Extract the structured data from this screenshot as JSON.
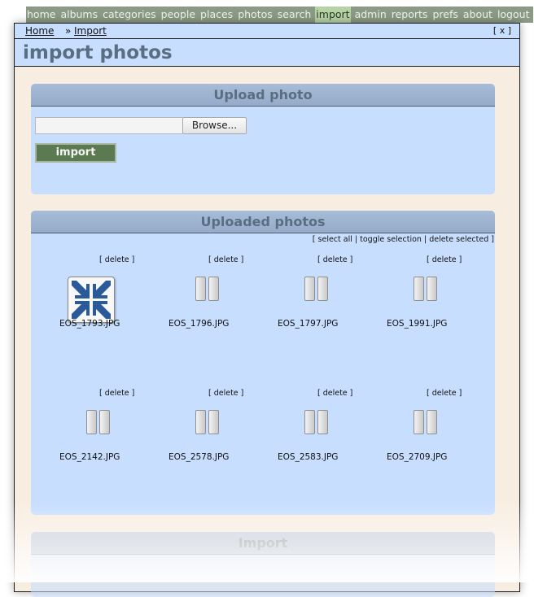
{
  "topnav": [
    {
      "label": "home",
      "active": false
    },
    {
      "label": "albums",
      "active": false
    },
    {
      "label": "categories",
      "active": false
    },
    {
      "label": "people",
      "active": false
    },
    {
      "label": "places",
      "active": false
    },
    {
      "label": "photos",
      "active": false
    },
    {
      "label": "search",
      "active": false
    },
    {
      "label": "import",
      "active": true
    },
    {
      "label": "admin",
      "active": false
    },
    {
      "label": "reports",
      "active": false
    },
    {
      "label": "prefs",
      "active": false
    },
    {
      "label": "about",
      "active": false
    },
    {
      "label": "logout",
      "active": false
    }
  ],
  "breadcrumb": {
    "home": "Home",
    "separator": "»",
    "current": "Import",
    "close": "[ x ]"
  },
  "page_title": "import photos",
  "upload": {
    "heading": "Upload photo",
    "file_value": "",
    "browse_label": "Browse...",
    "import_label": "import"
  },
  "uploaded": {
    "heading": "Uploaded photos",
    "actions": {
      "select_all": "select all",
      "toggle": "toggle selection",
      "delete_selected": "delete selected"
    },
    "delete_label": "[ delete ]",
    "photos": [
      {
        "name": "EOS_1793.JPG",
        "icon": "shrink-arrows-icon"
      },
      {
        "name": "EOS_1796.JPG",
        "icon": "pause-icon"
      },
      {
        "name": "EOS_1797.JPG",
        "icon": "pause-icon"
      },
      {
        "name": "EOS_1991.JPG",
        "icon": "pause-icon"
      },
      {
        "name": "EOS_2142.JPG",
        "icon": "pause-icon"
      },
      {
        "name": "EOS_2578.JPG",
        "icon": "pause-icon"
      },
      {
        "name": "EOS_2583.JPG",
        "icon": "pause-icon"
      },
      {
        "name": "EOS_2709.JPG",
        "icon": "pause-icon"
      }
    ]
  },
  "import_panel": {
    "heading": "Import"
  },
  "colors": {
    "panel_bg": "#c8deff",
    "window_bg": "#f8ede1",
    "heading_text": "#5a6e82",
    "import_button": "#5c7a52",
    "nav_bg": "#8a9a84",
    "nav_active": "#b8d2a8",
    "shrink_icon": "#2a5a9a"
  }
}
